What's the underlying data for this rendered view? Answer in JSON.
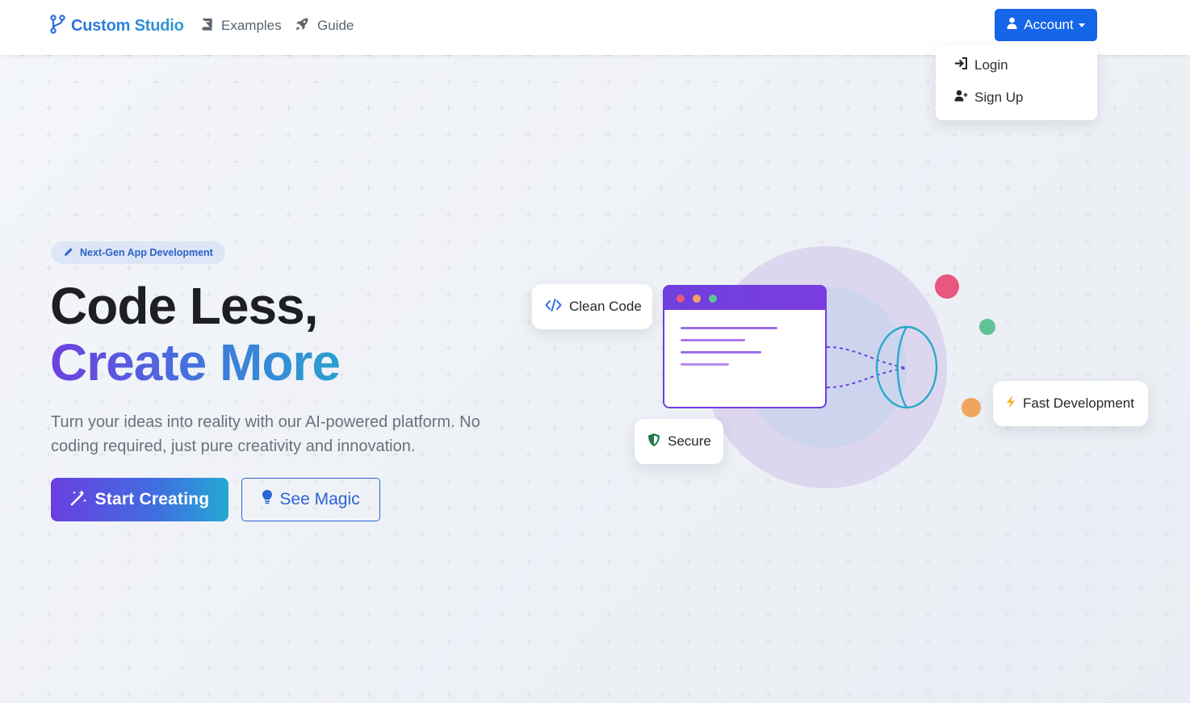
{
  "navbar": {
    "brand": "Custom Studio",
    "links": [
      {
        "label": "Examples",
        "icon": "book-icon"
      },
      {
        "label": "Guide",
        "icon": "rocket-icon"
      }
    ],
    "account_label": "Account",
    "account_menu": [
      {
        "label": "Login",
        "icon": "login-icon"
      },
      {
        "label": "Sign Up",
        "icon": "user-plus-icon"
      }
    ]
  },
  "hero": {
    "badge": "Next-Gen App Development",
    "title_line1": "Code Less,",
    "title_line2": "Create More",
    "subtitle": "Turn your ideas into reality with our AI-powered platform. No coding required, just pure creativity and innovation.",
    "primary_cta": "Start Creating",
    "secondary_cta": "See Magic"
  },
  "illustration": {
    "cards": [
      {
        "label": "Clean Code",
        "icon": "code-icon"
      },
      {
        "label": "Secure",
        "icon": "shield-icon"
      },
      {
        "label": "Fast Development",
        "icon": "lightning-icon"
      }
    ]
  },
  "colors": {
    "primary": "#1565e8",
    "accent_purple": "#6f3fe0",
    "accent_teal": "#2aa1cf",
    "dot_pink": "#e8587e",
    "dot_green": "#5ec495",
    "dot_orange": "#f0a55e"
  }
}
